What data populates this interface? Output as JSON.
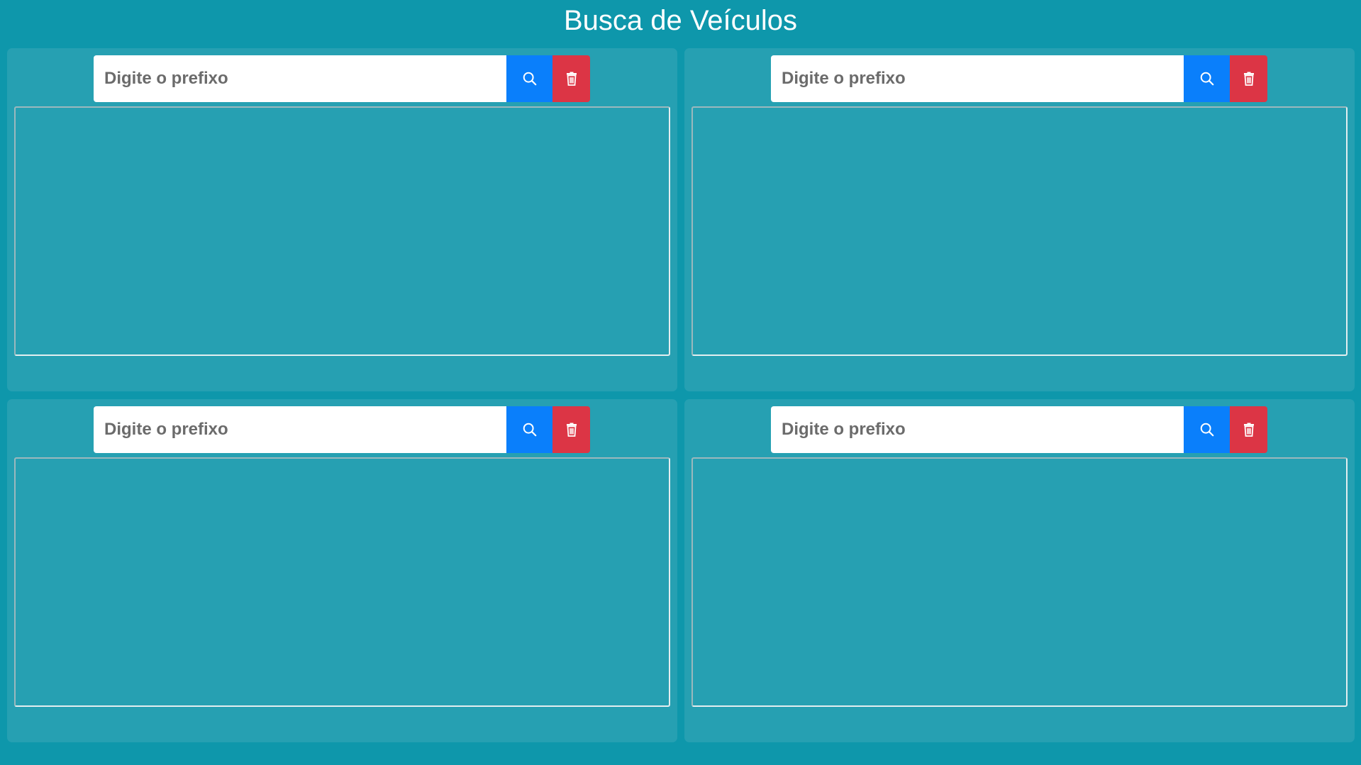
{
  "page": {
    "title": "Busca de Veículos"
  },
  "panels": [
    {
      "search": {
        "placeholder": "Digite o prefixo",
        "value": ""
      },
      "results": []
    },
    {
      "search": {
        "placeholder": "Digite o prefixo",
        "value": ""
      },
      "results": []
    },
    {
      "search": {
        "placeholder": "Digite o prefixo",
        "value": ""
      },
      "results": []
    },
    {
      "search": {
        "placeholder": "Digite o prefixo",
        "value": ""
      },
      "results": []
    }
  ],
  "icons": {
    "search": "search-icon",
    "clear": "trash-icon"
  },
  "colors": {
    "page_background": "#0e97ab",
    "panel_background": "#26a0b2",
    "search_button": "#0a7ffb",
    "clear_button": "#dc3545",
    "title_text": "#ffffff"
  }
}
